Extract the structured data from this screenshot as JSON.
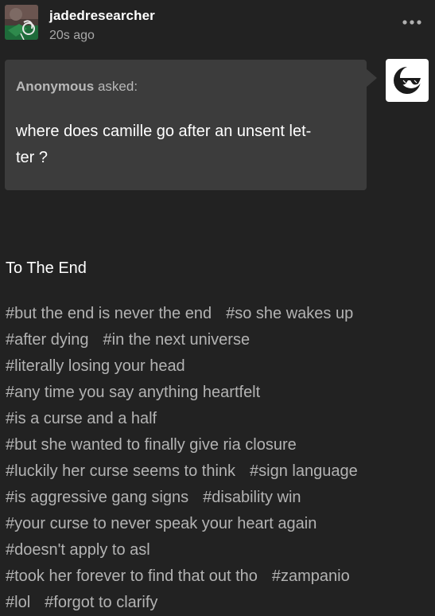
{
  "header": {
    "username": "jadedresearcher",
    "timestamp": "20s ago",
    "more_icon": "more-horizontal-icon"
  },
  "ask": {
    "asker_name": "Anonymous",
    "asked_suffix": " asked:",
    "question_line1": "where does camille go after an unsent let-",
    "question_line2": "ter ?",
    "asker_avatar_icon": "sunglasses-moon-icon"
  },
  "answer": {
    "text": "To The End"
  },
  "tags": [
    [
      "#but the end is never the end",
      "#so she wakes up"
    ],
    [
      "#after dying",
      "#in the next universe"
    ],
    [
      "#literally losing your head"
    ],
    [
      "#any time you say anything heartfelt"
    ],
    [
      "#is a curse and a half"
    ],
    [
      "#but she wanted to finally give ria closure"
    ],
    [
      "#luckily her curse seems to think",
      "#sign language"
    ],
    [
      "#is aggressive gang signs",
      "#disability win"
    ],
    [
      "#your curse to never speak your heart again"
    ],
    [
      "#doesn't apply to asl"
    ],
    [
      "#took her forever to find that out tho",
      "#zampanio"
    ],
    [
      "#lol",
      "#forgot to clarify"
    ]
  ],
  "colors": {
    "background": "#222222",
    "bubble": "#3c3c3c",
    "tag_text": "#b3b3b3",
    "muted_text": "#a8a8a8"
  }
}
